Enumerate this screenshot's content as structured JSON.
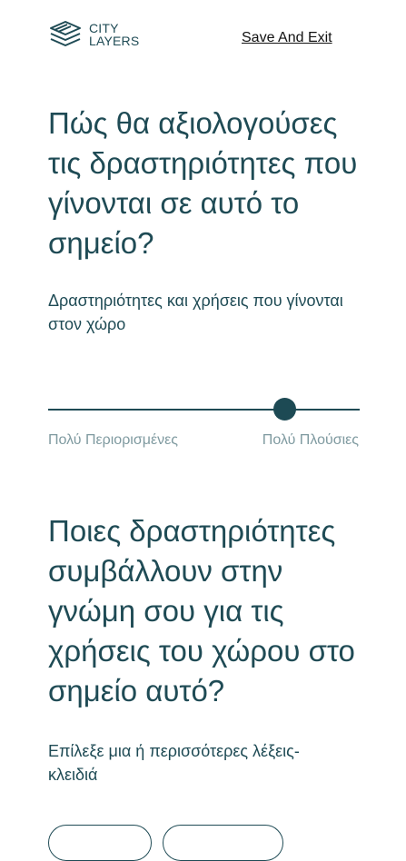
{
  "header": {
    "logo_line1": "CITY",
    "logo_line2": "LAYERS",
    "save_exit_label": "Save And Exit"
  },
  "question1": {
    "title": "Πώς θα αξιολογούσες τις δραστηριότητες που γίνονται σε αυτό το σημείο?",
    "subtitle": "Δραστηριότητες και χρήσεις που γίνονται στον χώρο",
    "slider": {
      "min_label": "Πολύ Περιορισμένες",
      "max_label": "Πολύ Πλούσιες",
      "value": 0.76
    }
  },
  "question2": {
    "title": "Ποιες δραστηριότητες συμβάλλουν στην γνώμη σου για τις χρήσεις του χώρου στο σημείο αυτό?",
    "subtitle": "Επίλεξε μια ή περισσότερες λέξεις-κλειδιά"
  },
  "colors": {
    "primary": "#1f4b55",
    "muted": "#7f9aa0",
    "background": "#ffffff"
  }
}
